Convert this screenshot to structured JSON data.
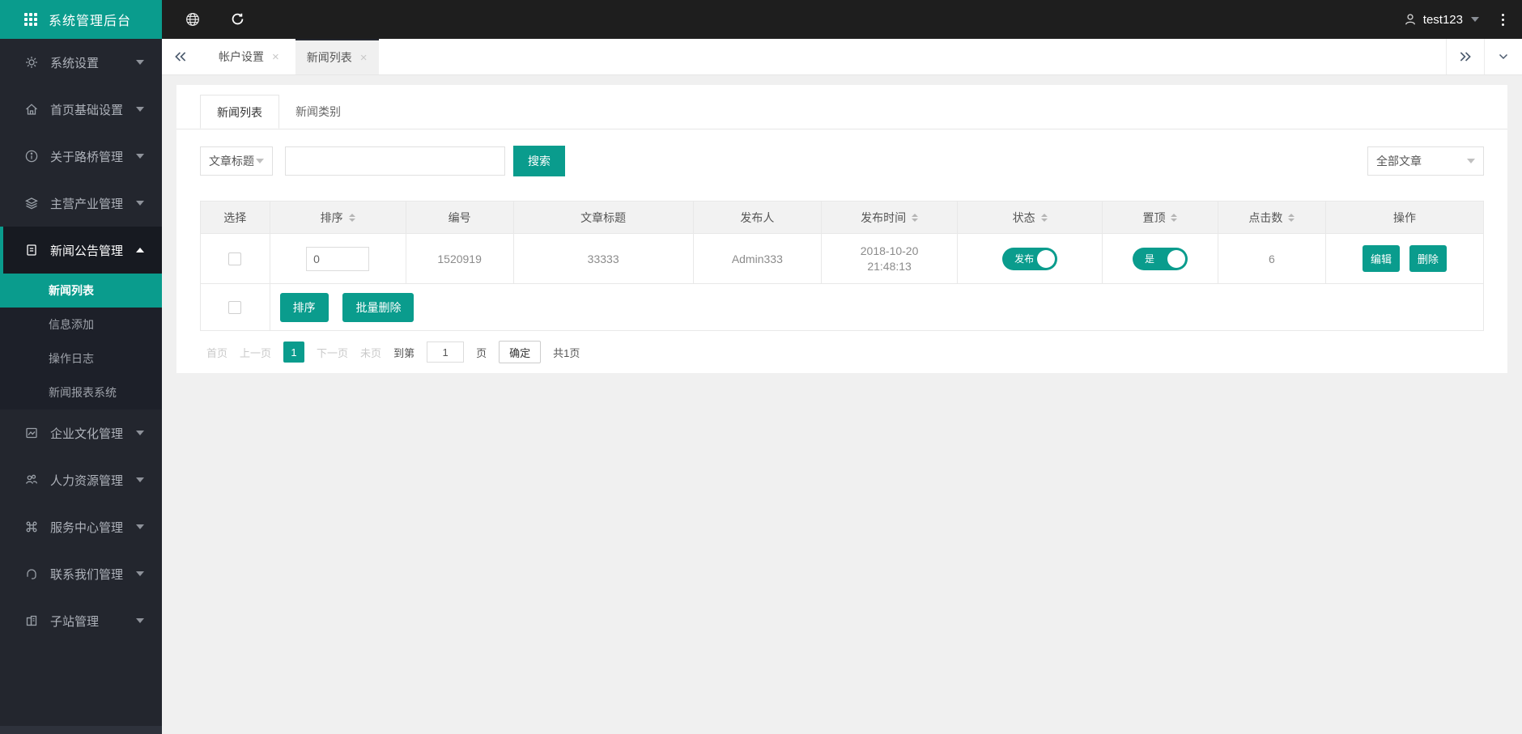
{
  "app": {
    "title": "系统管理后台",
    "username": "test123"
  },
  "colors": {
    "accent": "#0A9C8D",
    "sidebar_bg": "#23262E",
    "topbar_bg": "#1E1E1E",
    "content_bg": "#F0F0F0"
  },
  "sidebar": {
    "items": [
      {
        "label": "系统设置",
        "icon": "gear-icon"
      },
      {
        "label": "首页基础设置",
        "icon": "home-icon"
      },
      {
        "label": "关于路桥管理",
        "icon": "info-icon"
      },
      {
        "label": "主营产业管理",
        "icon": "layers-icon"
      },
      {
        "label": "新闻公告管理",
        "icon": "file-icon",
        "expanded": true,
        "children": [
          {
            "label": "新闻列表",
            "active": true
          },
          {
            "label": "信息添加"
          },
          {
            "label": "操作日志"
          },
          {
            "label": "新闻报表系统"
          }
        ]
      },
      {
        "label": "企业文化管理",
        "icon": "image-icon"
      },
      {
        "label": "人力资源管理",
        "icon": "users-icon"
      },
      {
        "label": "服务中心管理",
        "icon": "command-icon"
      },
      {
        "label": "联系我们管理",
        "icon": "headset-icon"
      },
      {
        "label": "子站管理",
        "icon": "building-icon"
      }
    ]
  },
  "tabbar": {
    "tabs": [
      {
        "label": "帐户设置",
        "close": "×"
      },
      {
        "label": "新闻列表",
        "close": "×",
        "active": true
      }
    ]
  },
  "page": {
    "tabs": [
      {
        "label": "新闻列表",
        "active": true
      },
      {
        "label": "新闻类别"
      }
    ],
    "filter": {
      "field": "文章标题",
      "keyword": "",
      "search": "搜索",
      "category": "全部文章"
    },
    "table": {
      "headers": [
        {
          "label": "选择",
          "sortable": false
        },
        {
          "label": "排序",
          "sortable": true
        },
        {
          "label": "编号",
          "sortable": false
        },
        {
          "label": "文章标题",
          "sortable": false
        },
        {
          "label": "发布人",
          "sortable": false
        },
        {
          "label": "发布时间",
          "sortable": true
        },
        {
          "label": "状态",
          "sortable": true
        },
        {
          "label": "置顶",
          "sortable": true
        },
        {
          "label": "点击数",
          "sortable": true
        },
        {
          "label": "操作",
          "sortable": false
        }
      ],
      "rows": [
        {
          "sort": "0",
          "id": "1520919",
          "title": "33333",
          "publisher": "Admin333",
          "date": "2018-10-20",
          "time": "21:48:13",
          "status": "发布",
          "top": "是",
          "clicks": "6",
          "edit": "编辑",
          "delete": "删除"
        }
      ],
      "bulk": {
        "sort": "排序",
        "batch_delete": "批量删除"
      }
    },
    "pagination": {
      "first": "首页",
      "prev": "上一页",
      "current": "1",
      "next": "下一页",
      "last": "未页",
      "goto_prefix": "到第",
      "goto_value": "1",
      "goto_suffix": "页",
      "confirm": "确定",
      "total": "共1页"
    }
  }
}
